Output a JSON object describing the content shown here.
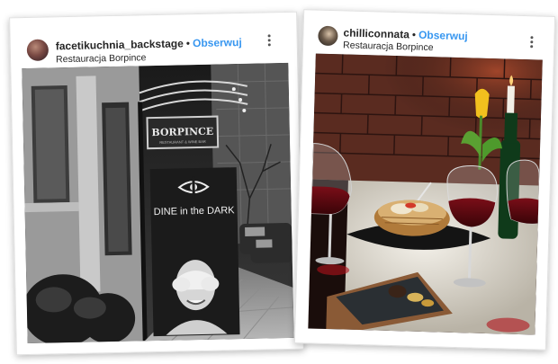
{
  "posts": [
    {
      "username": "facetikuchnia_backstage",
      "separator": "•",
      "follow_label": "Obserwuj",
      "location": "Restauracja Borpince",
      "photo": {
        "sign_text": "BORPINCE",
        "sign_subtext": "RESTAURANT & WINE BAR",
        "banner_text": "DINE in the DARK",
        "style": "black-and-white"
      }
    },
    {
      "username": "chilliconnata",
      "separator": "•",
      "follow_label": "Obserwuj",
      "location": "Restauracja Borpince",
      "photo": {
        "style": "color"
      }
    }
  ],
  "colors": {
    "follow_blue": "#3897f0",
    "text_dark": "#262626"
  },
  "icons": [
    "more-options-icon",
    "eye-icon"
  ]
}
